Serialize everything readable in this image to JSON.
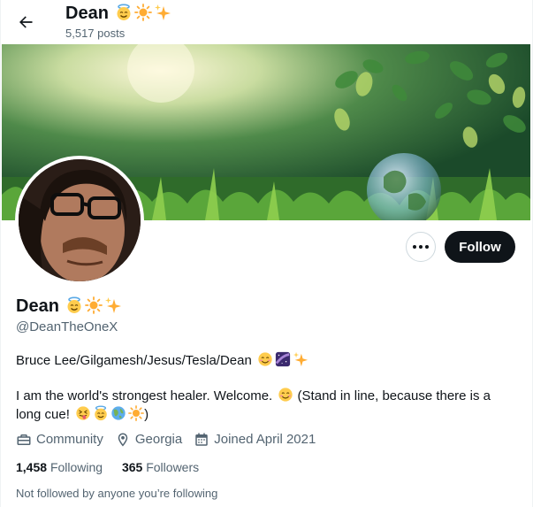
{
  "header": {
    "name": "Dean",
    "posts_count": "5,517 posts"
  },
  "profile": {
    "display_name": "Dean",
    "handle": "@DeanTheOneX",
    "bio_line1": "Bruce Lee/Gilgamesh/Jesus/Tesla/Dean",
    "bio_line2": "I am the world's strongest healer. Welcome.",
    "bio_line2b": " (Stand in line, because there is a long cue!",
    "bio_line2c": ")",
    "category": "Community",
    "location": "Georgia",
    "joined": "Joined April 2021",
    "following_count": "1,458",
    "following_label": "Following",
    "followers_count": "365",
    "followers_label": "Followers",
    "not_followed_text": "Not followed by anyone you’re following"
  },
  "actions": {
    "follow_label": "Follow"
  },
  "icons": {
    "back": "arrow-left-icon",
    "more": "more-horizontal-icon",
    "category": "briefcase-icon",
    "location": "location-pin-icon",
    "joined": "calendar-icon",
    "name_emojis": [
      "halo-smile-emoji",
      "sun-emoji",
      "sparkles-emoji"
    ]
  },
  "colors": {
    "text_primary": "#0f1419",
    "text_secondary": "#536471",
    "follow_bg": "#0f1419",
    "follow_text": "#ffffff"
  }
}
